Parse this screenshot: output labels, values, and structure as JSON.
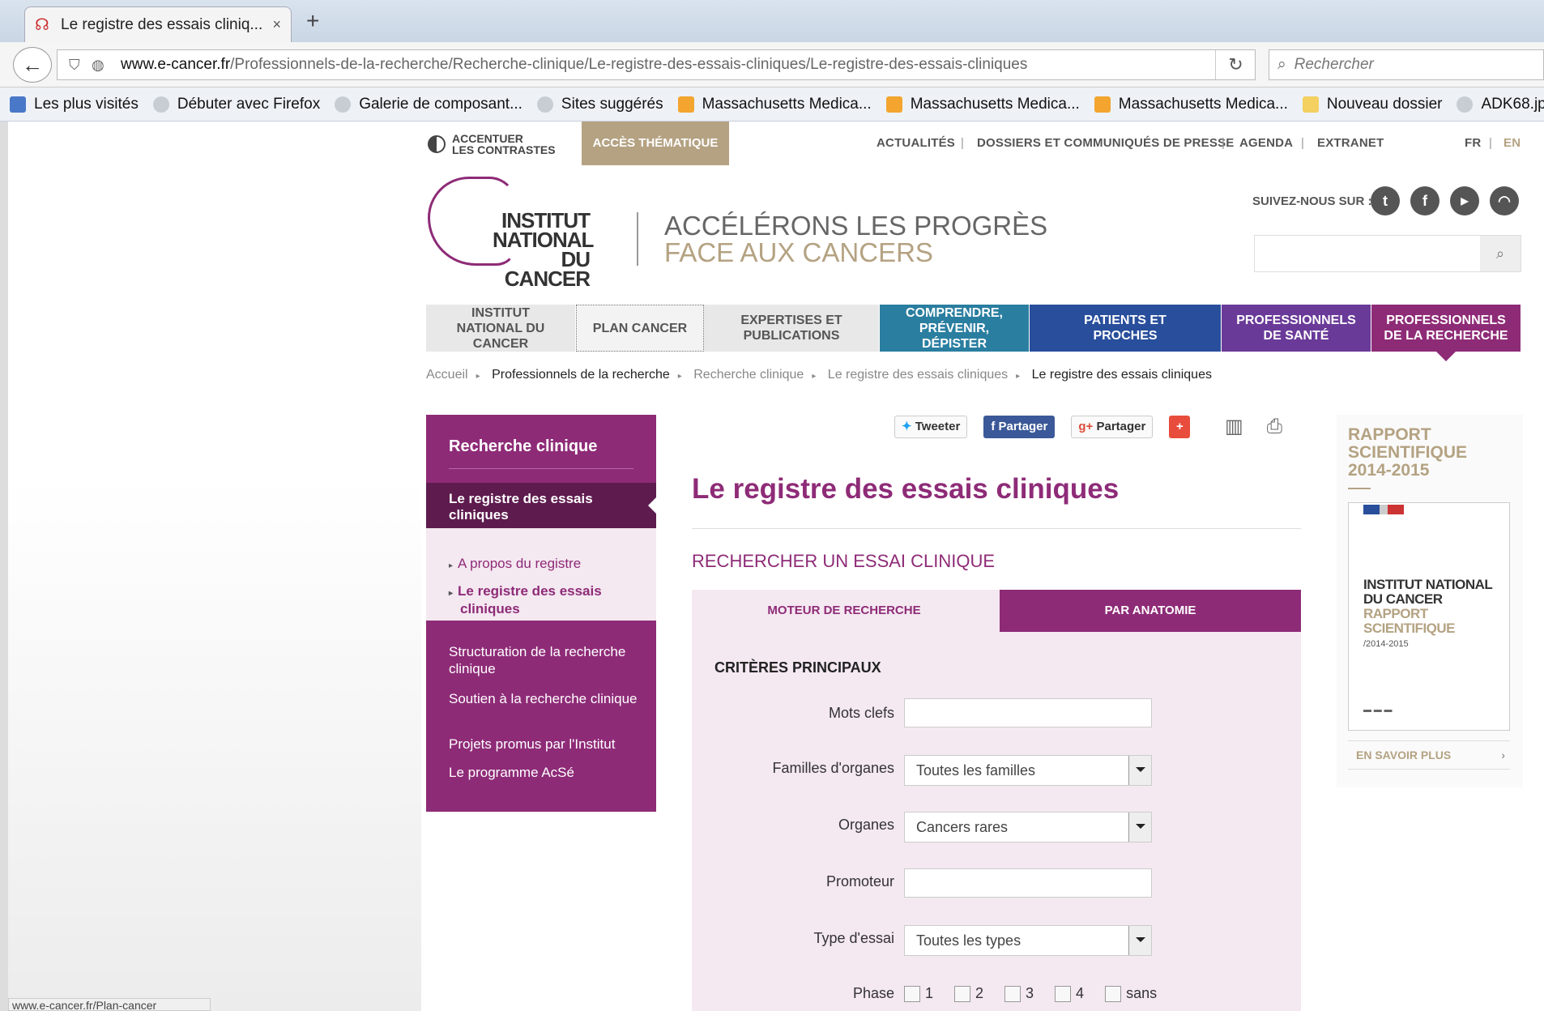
{
  "browser": {
    "tab_title": "Le registre des essais cliniq...",
    "tab_close": "×",
    "new_tab": "+",
    "url_domain": "www.e-cancer.fr",
    "url_path": "/Professionnels-de-la-recherche/Recherche-clinique/Le-registre-des-essais-cliniques/Le-registre-des-essais-cliniques",
    "search_placeholder": "Rechercher",
    "bookmarks": [
      "Les plus visités",
      "Débuter avec Firefox",
      "Galerie de composant...",
      "Sites suggérés",
      "Massachusetts Medica...",
      "Massachusetts Medica...",
      "Massachusetts Medica...",
      "Nouveau dossier",
      "ADK68.jpg"
    ],
    "status_text": "www.e-cancer.fr/Plan-cancer"
  },
  "header": {
    "contrast_label_1": "ACCENTUER",
    "contrast_label_2": "LES CONTRASTES",
    "acces_thematique": "ACCÈS THÉMATIQUE",
    "top_links": [
      "ACTUALITÉS",
      "DOSSIERS ET COMMUNIQUÉS DE PRESSE",
      "AGENDA",
      "EXTRANET"
    ],
    "lang_fr": "FR",
    "lang_en": "EN",
    "logo_line1": "INSTITUT",
    "logo_line2": "NATIONAL",
    "logo_line3": "DU CANCER",
    "tagline_1": "ACCÉLÉRONS LES PROGRÈS",
    "tagline_2": "FACE AUX CANCERS",
    "follow_label": "SUIVEZ-NOUS SUR :"
  },
  "main_nav": [
    {
      "label": "INSTITUT NATIONAL DU CANCER"
    },
    {
      "label": "PLAN CANCER"
    },
    {
      "label": "EXPERTISES ET PUBLICATIONS"
    },
    {
      "label": "COMPRENDRE, PRÉVENIR, DÉPISTER"
    },
    {
      "label": "PATIENTS ET PROCHES"
    },
    {
      "label": "PROFESSIONNELS DE SANTÉ"
    },
    {
      "label": "PROFESSIONNELS DE LA RECHERCHE"
    }
  ],
  "breadcrumb": [
    "Accueil",
    "Professionnels de la recherche",
    "Recherche clinique",
    "Le registre des essais cliniques",
    "Le registre des essais cliniques"
  ],
  "sidebar": {
    "title": "Recherche clinique",
    "active": "Le registre des essais cliniques",
    "sub_items": [
      "A propos du registre",
      "Le registre des essais cliniques"
    ],
    "items": [
      "Structuration de la recherche clinique",
      "Soutien à la recherche clinique",
      "Projets promus par l'Institut",
      "Le programme AcSé"
    ]
  },
  "share": {
    "tweet": "Tweeter",
    "facebook": "Partager",
    "gplus": "Partager",
    "plus": "+"
  },
  "content": {
    "title": "Le registre des essais cliniques",
    "subtitle": "RECHERCHER UN ESSAI CLINIQUE",
    "tab_moteur": "MOTEUR DE RECHERCHE",
    "tab_anatomie": "PAR ANATOMIE",
    "criteria_title": "CRITÈRES PRINCIPAUX",
    "fields": {
      "mots_clefs_label": "Mots clefs",
      "mots_clefs_value": "",
      "familles_label": "Familles d'organes",
      "familles_value": "Toutes les familles",
      "organes_label": "Organes",
      "organes_value": "Cancers rares",
      "promoteur_label": "Promoteur",
      "promoteur_value": "",
      "type_label": "Type d'essai",
      "type_value": "Toutes les types",
      "phase_label": "Phase",
      "phase_options": [
        "1",
        "2",
        "3",
        "4",
        "sans"
      ]
    }
  },
  "rapport": {
    "title": "RAPPORT SCIENTIFIQUE 2014-2015",
    "book_line1": "INSTITUT NATIONAL DU CANCER",
    "book_line2": "RAPPORT SCIENTIFIQUE",
    "book_line3": "/2014-2015",
    "more": "EN SAVOIR PLUS",
    "more_chevron": "›"
  },
  "colors": {
    "accent": "#8e2b77",
    "beige": "#b4a282",
    "teal": "#2a7ea0",
    "blue": "#284e9c",
    "violet": "#6a3a98"
  }
}
